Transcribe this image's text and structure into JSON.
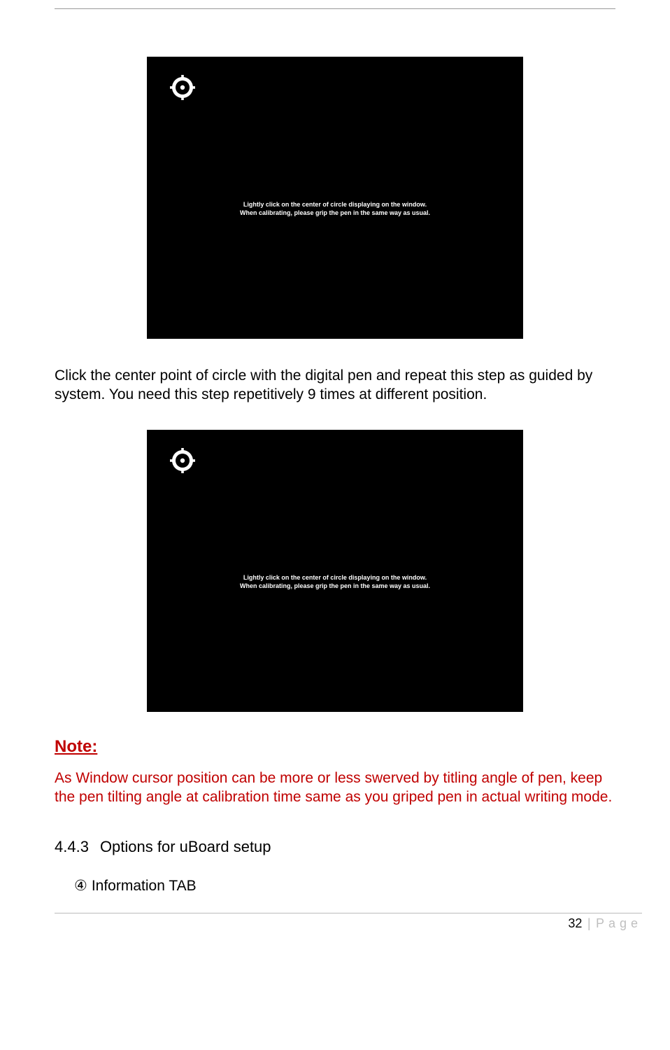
{
  "calibration": {
    "line1": "Lightly click on the center of circle displaying on the window.",
    "line2": "When calibrating, please grip the pen in the same way as usual."
  },
  "paragraph1": "Click the center point of circle with the digital pen and repeat this step as guided by system. You need this step repetitively 9 times at different position.",
  "note": {
    "label": "Note:",
    "body": "As Window cursor position can be more or less swerved by titling angle of pen, keep the pen tilting angle at calibration time same as you griped pen in actual writing mode."
  },
  "section": {
    "number": "4.4.3",
    "title": "Options for uBoard setup"
  },
  "listItem": {
    "marker": "④",
    "text": "Information TAB"
  },
  "footer": {
    "pageNum": "32",
    "sep": "|",
    "word": "Page"
  }
}
